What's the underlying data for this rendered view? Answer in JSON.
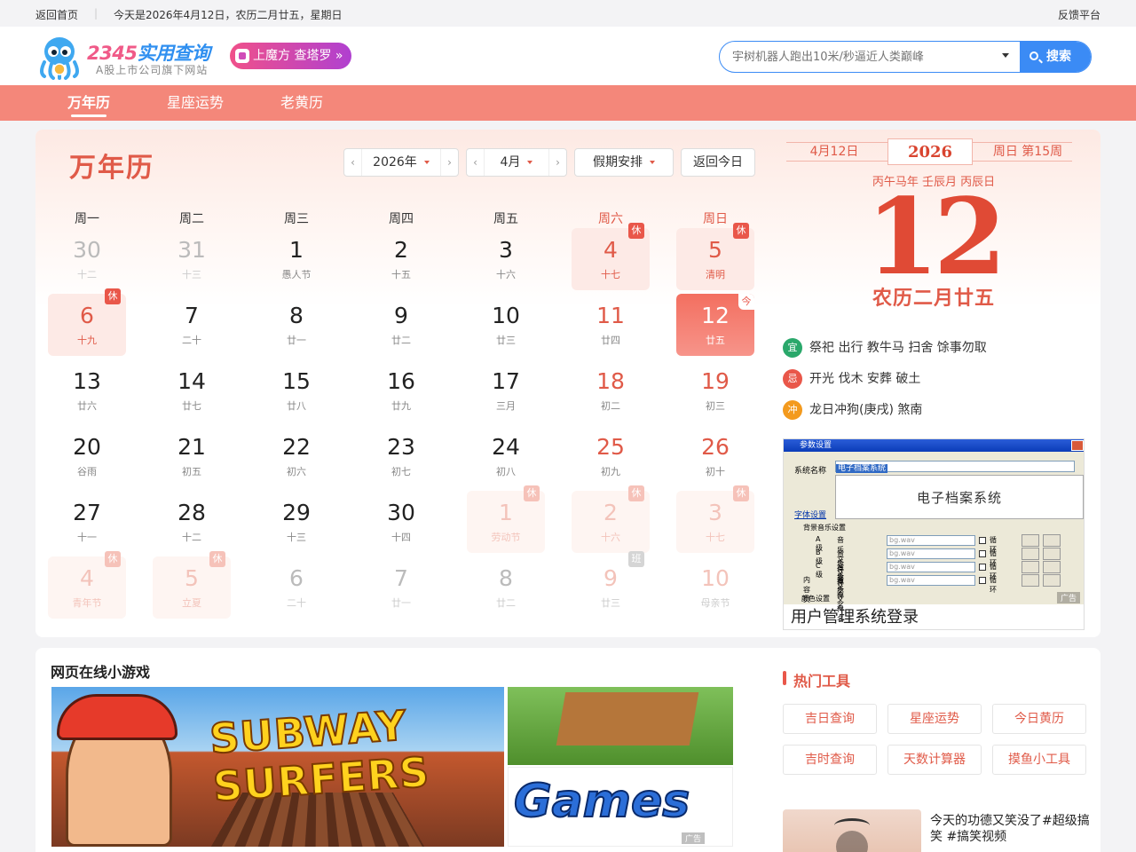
{
  "topbar": {
    "home": "返回首页",
    "date_text": "今天是2026年4月12日，农历二月廿五，星期日",
    "feedback": "反馈平台"
  },
  "header": {
    "logo_brand_num": "2345",
    "logo_brand_text": "实用查询",
    "logo_sub": "A股上市公司旗下网站",
    "promo": "上魔方 查塔罗 »",
    "search_placeholder": "宇树机器人跑出10米/秒逼近人类巅峰",
    "search_button": "搜索"
  },
  "nav": [
    {
      "label": "万年历",
      "active": true
    },
    {
      "label": "星座运势",
      "active": false
    },
    {
      "label": "老黄历",
      "active": false
    }
  ],
  "calendar": {
    "title": "万年历",
    "year_select": "2026年",
    "month_select": "4月",
    "holiday_select": "假期安排",
    "today_button": "返回今日",
    "weekdays": [
      "周一",
      "周二",
      "周三",
      "周四",
      "周五",
      "周六",
      "周日"
    ],
    "weeks": [
      [
        {
          "d": "30",
          "l": "十二",
          "other": true
        },
        {
          "d": "31",
          "l": "十三",
          "other": true
        },
        {
          "d": "1",
          "l": "愚人节"
        },
        {
          "d": "2",
          "l": "十五"
        },
        {
          "d": "3",
          "l": "十六"
        },
        {
          "d": "4",
          "l": "十七",
          "hol": true,
          "badge": "休"
        },
        {
          "d": "5",
          "l": "清明",
          "hol": true,
          "badge": "休"
        }
      ],
      [
        {
          "d": "6",
          "l": "十九",
          "hol": true,
          "badge": "休"
        },
        {
          "d": "7",
          "l": "二十"
        },
        {
          "d": "8",
          "l": "廿一"
        },
        {
          "d": "9",
          "l": "廿二"
        },
        {
          "d": "10",
          "l": "廿三"
        },
        {
          "d": "11",
          "l": "廿四"
        },
        {
          "d": "12",
          "l": "廿五",
          "today": true,
          "badge": "今"
        }
      ],
      [
        {
          "d": "13",
          "l": "廿六"
        },
        {
          "d": "14",
          "l": "廿七"
        },
        {
          "d": "15",
          "l": "廿八"
        },
        {
          "d": "16",
          "l": "廿九"
        },
        {
          "d": "17",
          "l": "三月"
        },
        {
          "d": "18",
          "l": "初二"
        },
        {
          "d": "19",
          "l": "初三"
        }
      ],
      [
        {
          "d": "20",
          "l": "谷雨"
        },
        {
          "d": "21",
          "l": "初五"
        },
        {
          "d": "22",
          "l": "初六"
        },
        {
          "d": "23",
          "l": "初七"
        },
        {
          "d": "24",
          "l": "初八"
        },
        {
          "d": "25",
          "l": "初九"
        },
        {
          "d": "26",
          "l": "初十"
        }
      ],
      [
        {
          "d": "27",
          "l": "十一"
        },
        {
          "d": "28",
          "l": "十二"
        },
        {
          "d": "29",
          "l": "十三"
        },
        {
          "d": "30",
          "l": "十四"
        },
        {
          "d": "1",
          "l": "劳动节",
          "other": true,
          "hol": true,
          "badge": "休"
        },
        {
          "d": "2",
          "l": "十六",
          "other": true,
          "hol": true,
          "badge": "休"
        },
        {
          "d": "3",
          "l": "十七",
          "other": true,
          "hol": true,
          "badge": "休"
        }
      ],
      [
        {
          "d": "4",
          "l": "青年节",
          "other": true,
          "hol": true,
          "badge": "休"
        },
        {
          "d": "5",
          "l": "立夏",
          "other": true,
          "hol": true,
          "badge": "休"
        },
        {
          "d": "6",
          "l": "二十",
          "other": true
        },
        {
          "d": "7",
          "l": "廿一",
          "other": true
        },
        {
          "d": "8",
          "l": "廿二",
          "other": true
        },
        {
          "d": "9",
          "l": "廿三",
          "other": true,
          "badge": "班",
          "work": true
        },
        {
          "d": "10",
          "l": "母亲节",
          "other": true
        }
      ]
    ]
  },
  "day_panel": {
    "month_day": "4月12日",
    "year": "2026",
    "week_info": "周日 第15周",
    "ganzhi": "丙午马年 壬辰月 丙辰日",
    "big_day": "12",
    "lunar": "农历二月廿五",
    "yi_icon": "宜",
    "yi": "祭祀 出行 教牛马 扫舍 馀事勿取",
    "ji_icon": "忌",
    "ji": "开光 伐木 安葬 破土",
    "chong_icon": "冲",
    "chong": "龙日冲狗(庚戌) 煞南",
    "colors": {
      "yi": "#2aa86b",
      "ji": "#e9574a",
      "chong": "#f39a1e"
    }
  },
  "ad_right": {
    "window_title": "参数设置",
    "system_name_label": "系统名称",
    "system_name_value": "电子档案系统",
    "big_text": "电子档案系统",
    "font_label": "字体设置",
    "bg_label": "背景音乐设置",
    "rows": [
      {
        "level": "A级",
        "label": "音乐文件名",
        "value": "bg.wav",
        "loop": "循环"
      },
      {
        "level": "B级",
        "label": "音乐文件名",
        "value": "bg.wav",
        "loop": "循环"
      },
      {
        "level": "C级",
        "label": "音乐文件名",
        "value": "bg.wav",
        "loop": "循环"
      },
      {
        "level": "内容页",
        "label": "音乐文件名",
        "value": "bg.wav",
        "loop": "循环"
      }
    ],
    "color_label": "颜色设置",
    "caption": "用户管理系统登录",
    "ad_tag": "广告"
  },
  "games": {
    "title": "网页在线小游戏",
    "game1_text": "SUBWAY SURFERS",
    "game3_text": "Games",
    "ad_tag": "广告"
  },
  "hot_tools": {
    "title": "热门工具",
    "items": [
      "吉日查询",
      "星座运势",
      "今日黄历",
      "吉时查询",
      "天数计算器",
      "摸鱼小工具"
    ]
  },
  "video": {
    "text": "今天的功德又笑没了#超级搞笑 #搞笑视频"
  }
}
